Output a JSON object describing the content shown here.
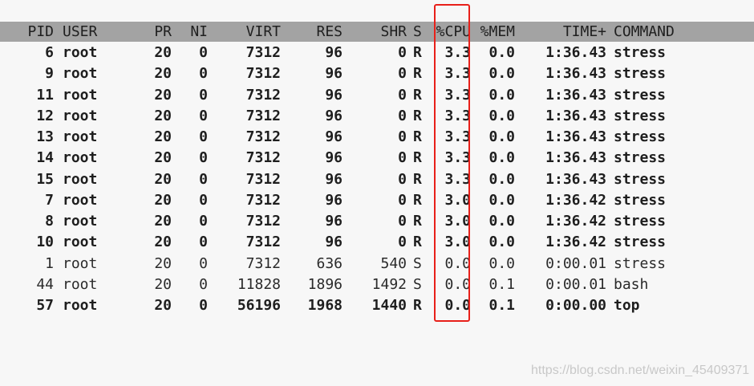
{
  "columns": {
    "pid": "PID",
    "user": "USER",
    "pr": "PR",
    "ni": "NI",
    "virt": "VIRT",
    "res": "RES",
    "shr": "SHR",
    "s": "S",
    "cpu": "%CPU",
    "mem": "%MEM",
    "time": "TIME+",
    "command": "COMMAND"
  },
  "processes": [
    {
      "pid": "6",
      "user": "root",
      "pr": "20",
      "ni": "0",
      "virt": "7312",
      "res": "96",
      "shr": "0",
      "s": "R",
      "cpu": "3.3",
      "mem": "0.0",
      "time": "1:36.43",
      "command": "stress"
    },
    {
      "pid": "9",
      "user": "root",
      "pr": "20",
      "ni": "0",
      "virt": "7312",
      "res": "96",
      "shr": "0",
      "s": "R",
      "cpu": "3.3",
      "mem": "0.0",
      "time": "1:36.43",
      "command": "stress"
    },
    {
      "pid": "11",
      "user": "root",
      "pr": "20",
      "ni": "0",
      "virt": "7312",
      "res": "96",
      "shr": "0",
      "s": "R",
      "cpu": "3.3",
      "mem": "0.0",
      "time": "1:36.43",
      "command": "stress"
    },
    {
      "pid": "12",
      "user": "root",
      "pr": "20",
      "ni": "0",
      "virt": "7312",
      "res": "96",
      "shr": "0",
      "s": "R",
      "cpu": "3.3",
      "mem": "0.0",
      "time": "1:36.43",
      "command": "stress"
    },
    {
      "pid": "13",
      "user": "root",
      "pr": "20",
      "ni": "0",
      "virt": "7312",
      "res": "96",
      "shr": "0",
      "s": "R",
      "cpu": "3.3",
      "mem": "0.0",
      "time": "1:36.43",
      "command": "stress"
    },
    {
      "pid": "14",
      "user": "root",
      "pr": "20",
      "ni": "0",
      "virt": "7312",
      "res": "96",
      "shr": "0",
      "s": "R",
      "cpu": "3.3",
      "mem": "0.0",
      "time": "1:36.43",
      "command": "stress"
    },
    {
      "pid": "15",
      "user": "root",
      "pr": "20",
      "ni": "0",
      "virt": "7312",
      "res": "96",
      "shr": "0",
      "s": "R",
      "cpu": "3.3",
      "mem": "0.0",
      "time": "1:36.43",
      "command": "stress"
    },
    {
      "pid": "7",
      "user": "root",
      "pr": "20",
      "ni": "0",
      "virt": "7312",
      "res": "96",
      "shr": "0",
      "s": "R",
      "cpu": "3.0",
      "mem": "0.0",
      "time": "1:36.42",
      "command": "stress"
    },
    {
      "pid": "8",
      "user": "root",
      "pr": "20",
      "ni": "0",
      "virt": "7312",
      "res": "96",
      "shr": "0",
      "s": "R",
      "cpu": "3.0",
      "mem": "0.0",
      "time": "1:36.42",
      "command": "stress"
    },
    {
      "pid": "10",
      "user": "root",
      "pr": "20",
      "ni": "0",
      "virt": "7312",
      "res": "96",
      "shr": "0",
      "s": "R",
      "cpu": "3.0",
      "mem": "0.0",
      "time": "1:36.42",
      "command": "stress"
    },
    {
      "pid": "1",
      "user": "root",
      "pr": "20",
      "ni": "0",
      "virt": "7312",
      "res": "636",
      "shr": "540",
      "s": "S",
      "cpu": "0.0",
      "mem": "0.0",
      "time": "0:00.01",
      "command": "stress"
    },
    {
      "pid": "44",
      "user": "root",
      "pr": "20",
      "ni": "0",
      "virt": "11828",
      "res": "1896",
      "shr": "1492",
      "s": "S",
      "cpu": "0.0",
      "mem": "0.1",
      "time": "0:00.01",
      "command": "bash"
    },
    {
      "pid": "57",
      "user": "root",
      "pr": "20",
      "ni": "0",
      "virt": "56196",
      "res": "1968",
      "shr": "1440",
      "s": "R",
      "cpu": "0.0",
      "mem": "0.1",
      "time": "0:00.00",
      "command": "top"
    }
  ],
  "watermark": "https://blog.csdn.net/weixin_45409371",
  "colors": {
    "background": "#f7f7f7",
    "header_bar": "#a3a3a3",
    "text": "#1e1e1e",
    "highlight_border": "#e8201a",
    "watermark": "#c8c8c8"
  }
}
